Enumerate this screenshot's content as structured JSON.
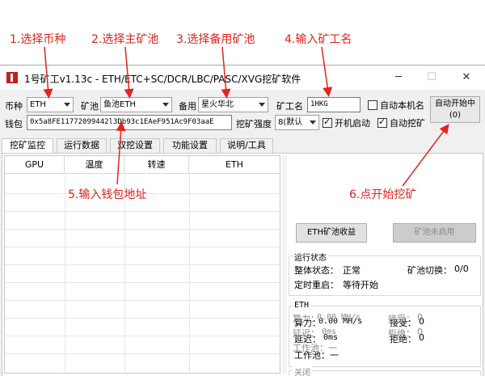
{
  "annotations": {
    "step1": "1.选择币种",
    "step2": "2.选择主矿池",
    "step3": "3.选择备用矿池",
    "step4": "4.输入矿工名",
    "step5": "5.输入钱包地址",
    "step6": "6.点开始挖矿"
  },
  "window": {
    "title": "1号矿工v1.13c - ETH/ETC+SC/DCR/LBC/PASC/XVG挖矿软件",
    "minimize": "─",
    "maximize": "☐",
    "close": "✕"
  },
  "config": {
    "coin_label": "币种",
    "coin_value": "ETH",
    "pool_label": "矿池",
    "pool_value": "鱼池ETH",
    "backup_label": "备用",
    "backup_value": "星火华北",
    "worker_label": "矿工名",
    "worker_value": "1HKG",
    "auto_name_label": "自动本机名",
    "auto_start_line1": "自动开始中",
    "auto_start_line2": "(0)",
    "wallet_label": "钱包",
    "wallet_value": "0x5a8FE11772099442l3Db93c1EAeF951Ac9F03aaE",
    "intensity_label": "挖矿强度",
    "intensity_value": "8(默认",
    "boot_start_label": "开机启动",
    "auto_mine_label": "自动挖矿"
  },
  "tabs": [
    "挖矿监控",
    "运行数据",
    "双挖设置",
    "功能设置",
    "说明/工具"
  ],
  "table": {
    "headers": [
      "GPU",
      "温度",
      "转速",
      "ETH"
    ]
  },
  "right_panel": {
    "eth_pool_profit": "ETH矿池收益",
    "pool_disabled": "矿池未启用",
    "status": {
      "title": "运行状态",
      "overall_label": "整体状态：",
      "overall_value": "正常",
      "pool_switch_label": "矿池切换：",
      "pool_switch_value": "0/0",
      "restart_label": "定时重启：",
      "restart_value": "等待开始"
    },
    "eth": {
      "title": "ETH",
      "hashrate_label": "算力：",
      "hashrate_value": "0.00 MH/s",
      "accepted_label": "接受：",
      "accepted_value": "0",
      "latency_label": "延迟：",
      "latency_value": "0ms",
      "rejected_label": "拒绝：",
      "rejected_value": "0",
      "pool_label": "工作池：",
      "pool_value": "一"
    },
    "off": {
      "title": "关闭",
      "hashrate_label": "算力：",
      "hashrate_value": "0.00 MH/s",
      "accepted_label": "接受：",
      "accepted_value": "0",
      "latency_label": "延迟：",
      "latency_value": "0ms",
      "rejected_label": "拒绝：",
      "rejected_value": "0",
      "pool_label": "工作池：",
      "pool_value": "一"
    }
  },
  "colors": {
    "annotation": "#e0251b",
    "window_bg": "#f0f0f0",
    "app_icon": "#c21f1f"
  }
}
